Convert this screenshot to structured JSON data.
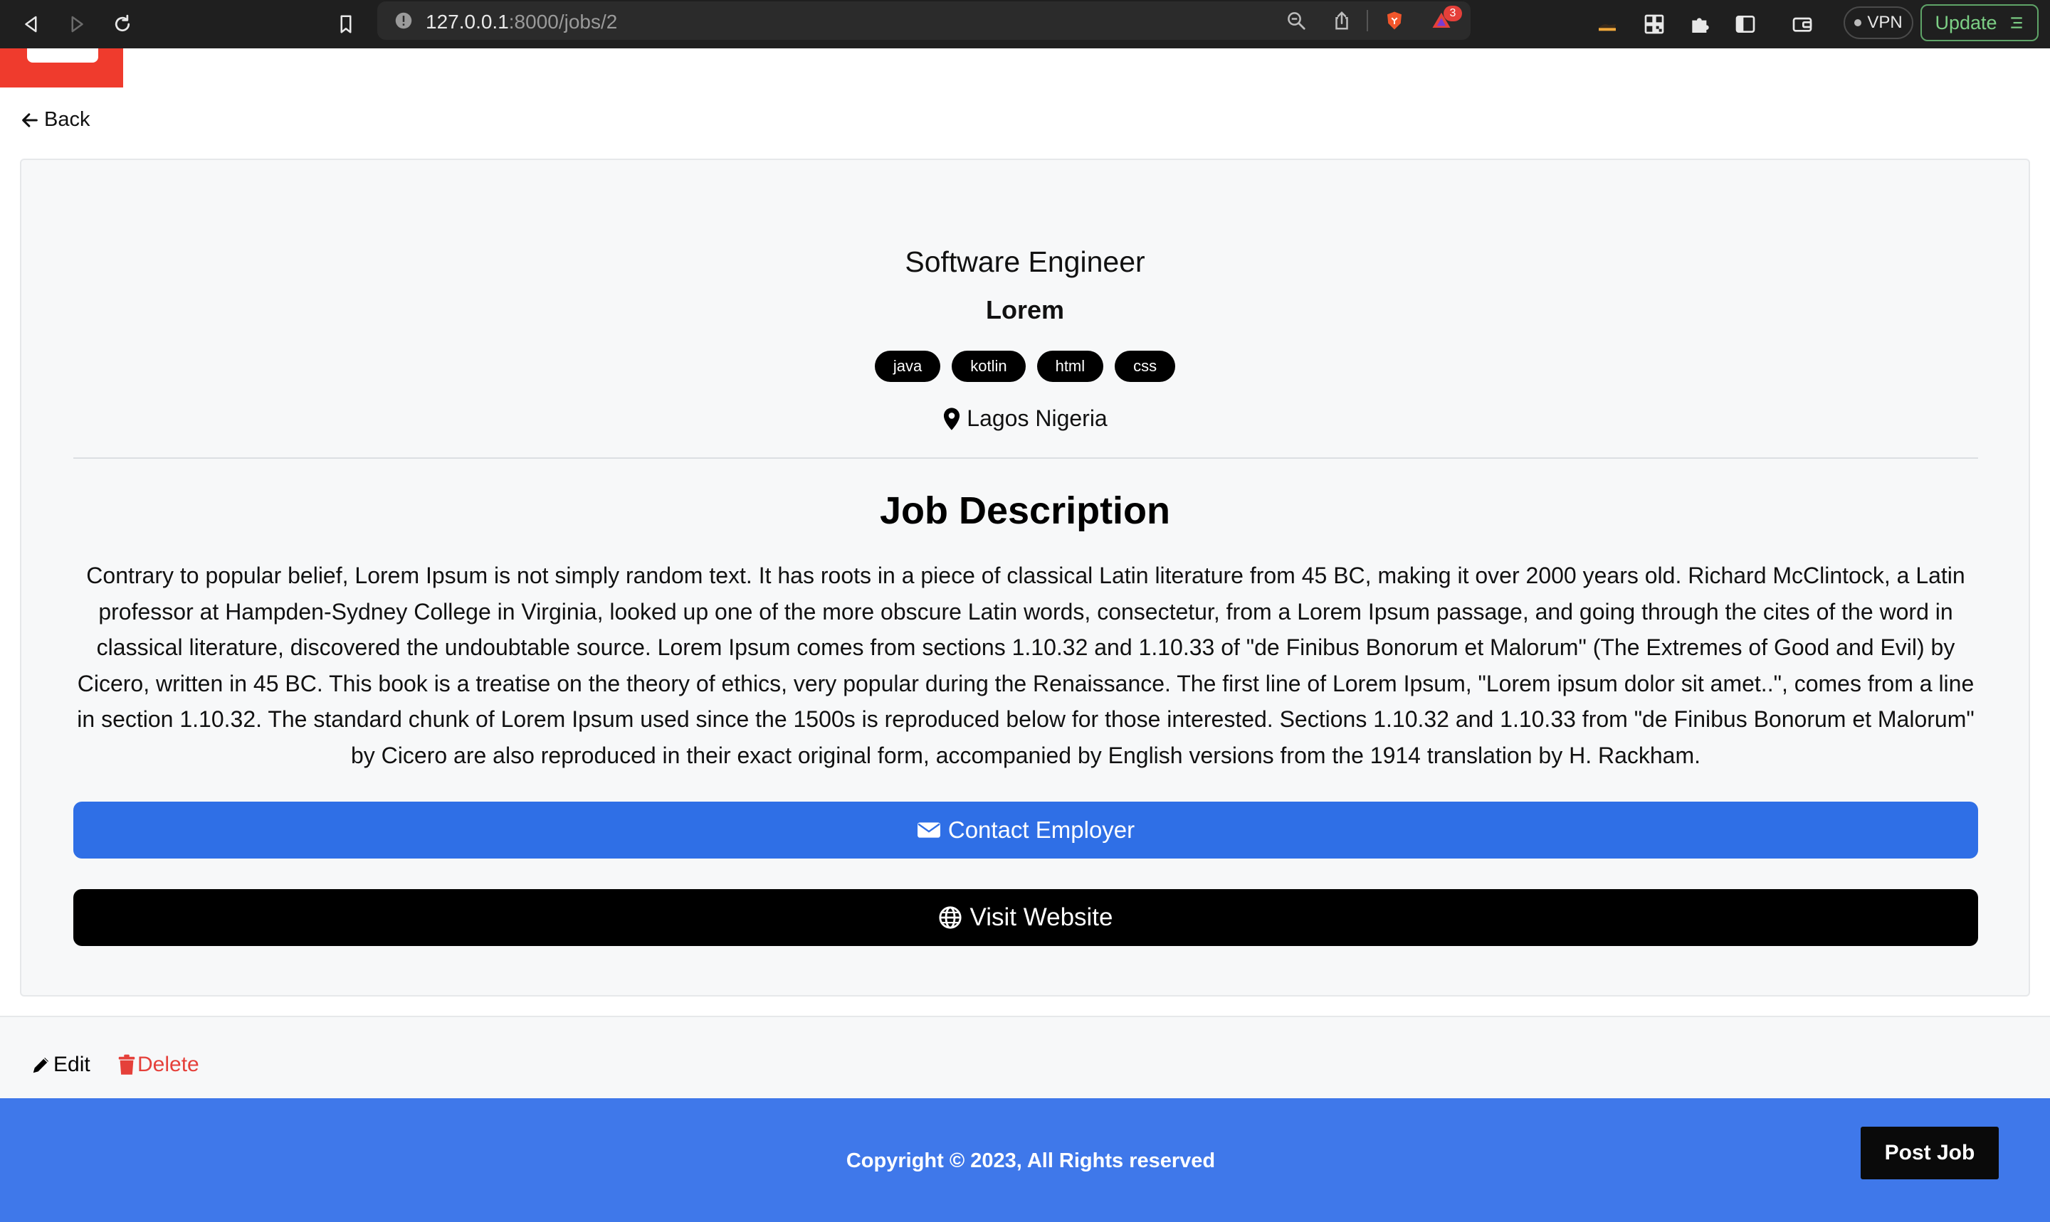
{
  "browser": {
    "url_host": "127.0.0.1",
    "url_rest": ":8000/jobs/2",
    "notification_count": "3",
    "vpn_label": "VPN",
    "update_label": "Update"
  },
  "page": {
    "back_label": "Back",
    "job": {
      "title": "Software Engineer",
      "company": "Lorem",
      "tags": [
        "java",
        "kotlin",
        "html",
        "css"
      ],
      "location": "Lagos Nigeria"
    },
    "description_heading": "Job Description",
    "description": "Contrary to popular belief, Lorem Ipsum is not simply random text. It has roots in a piece of classical Latin literature from 45 BC, making it over 2000 years old. Richard McClintock, a Latin professor at Hampden-Sydney College in Virginia, looked up one of the more obscure Latin words, consectetur, from a Lorem Ipsum passage, and going through the cites of the word in classical literature, discovered the undoubtable source. Lorem Ipsum comes from sections 1.10.32 and 1.10.33 of \"de Finibus Bonorum et Malorum\" (The Extremes of Good and Evil) by Cicero, written in 45 BC. This book is a treatise on the theory of ethics, very popular during the Renaissance. The first line of Lorem Ipsum, \"Lorem ipsum dolor sit amet..\", comes from a line in section 1.10.32. The standard chunk of Lorem Ipsum used since the 1500s is reproduced below for those interested. Sections 1.10.32 and 1.10.33 from \"de Finibus Bonorum et Malorum\" by Cicero are also reproduced in their exact original form, accompanied by English versions from the 1914 translation by H. Rackham.",
    "contact_label": "Contact Employer",
    "visit_label": "Visit Website",
    "edit_label": "Edit",
    "delete_label": "Delete"
  },
  "footer": {
    "copyright": "Copyright © 2023, All Rights reserved",
    "post_job_label": "Post Job"
  },
  "colors": {
    "chrome_bg": "#1f1f1f",
    "logo_red": "#ef3b2d",
    "primary_blue": "#2f6fe6",
    "footer_blue": "#3f78ea",
    "delete_red": "#e5403a",
    "update_green": "#7ccf85"
  },
  "icons": [
    "back-triangle-icon",
    "forward-triangle-icon",
    "reload-icon",
    "bookmark-icon",
    "site-info-icon",
    "zoom-icon",
    "share-icon",
    "brave-shield-icon",
    "brave-rewards-icon",
    "extension-icon",
    "qr-code-icon",
    "puzzle-icon",
    "sidebar-icon",
    "wallet-icon",
    "arrow-left-icon",
    "map-marker-icon",
    "envelope-icon",
    "globe-icon",
    "pencil-icon",
    "trash-icon",
    "menu-icon"
  ]
}
